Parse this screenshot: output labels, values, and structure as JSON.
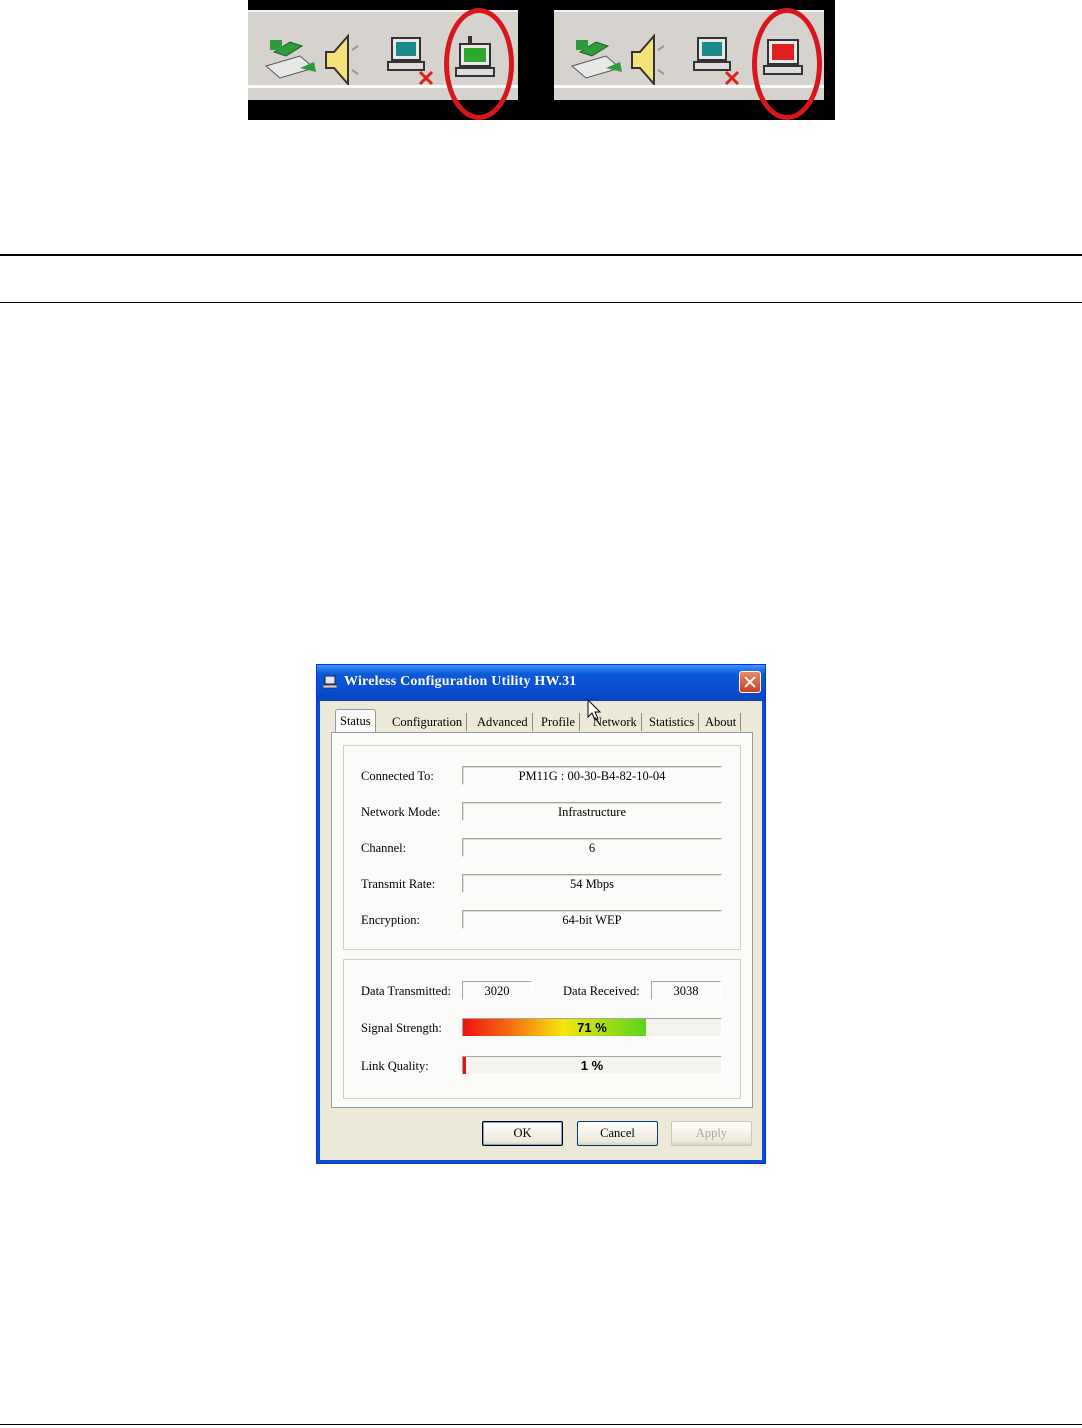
{
  "tray_icons": {
    "left": {
      "status_icon": "adapter-connected-icon",
      "status_color": "#2ea82e"
    },
    "right": {
      "status_icon": "adapter-disconnected-icon",
      "status_color": "#e02020"
    },
    "highlight_color": "#d8161b"
  },
  "dialog": {
    "title": "Wireless Configuration Utility HW.31",
    "tabs": [
      "Status",
      "Configuration",
      "Advanced",
      "Profile",
      "Network",
      "Statistics",
      "About"
    ],
    "active_tab": "Status",
    "status": {
      "connected_to_label": "Connected To:",
      "connected_to": "PM11G : 00-30-B4-82-10-04",
      "network_mode_label": "Network Mode:",
      "network_mode": "Infrastructure",
      "channel_label": "Channel:",
      "channel": "6",
      "transmit_rate_label": "Transmit Rate:",
      "transmit_rate": "54 Mbps",
      "encryption_label": "Encryption:",
      "encryption": "64-bit WEP"
    },
    "traffic": {
      "data_transmitted_label": "Data Transmitted:",
      "data_transmitted": "3020",
      "data_received_label": "Data Received:",
      "data_received": "3038",
      "signal_strength_label": "Signal Strength:",
      "signal_strength_text": "71 %",
      "signal_strength_value": 71,
      "link_quality_label": "Link Quality:",
      "link_quality_text": "1 %",
      "link_quality_value": 1
    },
    "buttons": {
      "ok": "OK",
      "cancel": "Cancel",
      "apply": "Apply"
    }
  }
}
